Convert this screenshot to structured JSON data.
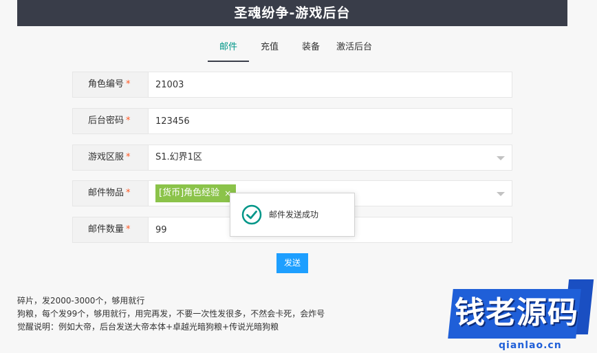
{
  "header": {
    "title": "圣魂纷争-游戏后台"
  },
  "tabs": [
    {
      "label": "邮件",
      "active": true
    },
    {
      "label": "充值",
      "active": false
    },
    {
      "label": "装备",
      "active": false
    },
    {
      "label": "激活后台",
      "active": false
    }
  ],
  "form": {
    "role_id": {
      "label": "角色编号",
      "required_mark": "*",
      "value": "21003"
    },
    "admin_password": {
      "label": "后台密码",
      "required_mark": "*",
      "value": "123456"
    },
    "server": {
      "label": "游戏区服",
      "required_mark": "*",
      "selected": "S1.幻界1区"
    },
    "mail_item": {
      "label": "邮件物品",
      "required_mark": "*",
      "selected_tag": "[货币]角色经验",
      "tag_close": "×"
    },
    "mail_quantity": {
      "label": "邮件数量",
      "required_mark": "*",
      "value": "99"
    }
  },
  "toast": {
    "message": "邮件发送成功"
  },
  "send_button": {
    "label": "发送"
  },
  "notes": [
    "碎片，发2000-3000个，够用就行",
    "狗粮，每个发99个，够用就行，用完再发，不要一次性发很多，不然会卡死，会炸号",
    "觉醒说明：例如大帝，后台发送大帝本体+卓越光暗狗粮+传说光暗狗粮"
  ],
  "watermark": {
    "text": "钱老源码",
    "url": "qianlao.cn"
  },
  "colors": {
    "header_bg": "#393d49",
    "active_tab": "#009688",
    "required": "#ff5722",
    "tag_bg": "#8bc34a",
    "button_bg": "#1e9fff",
    "success_icon": "#009688"
  }
}
